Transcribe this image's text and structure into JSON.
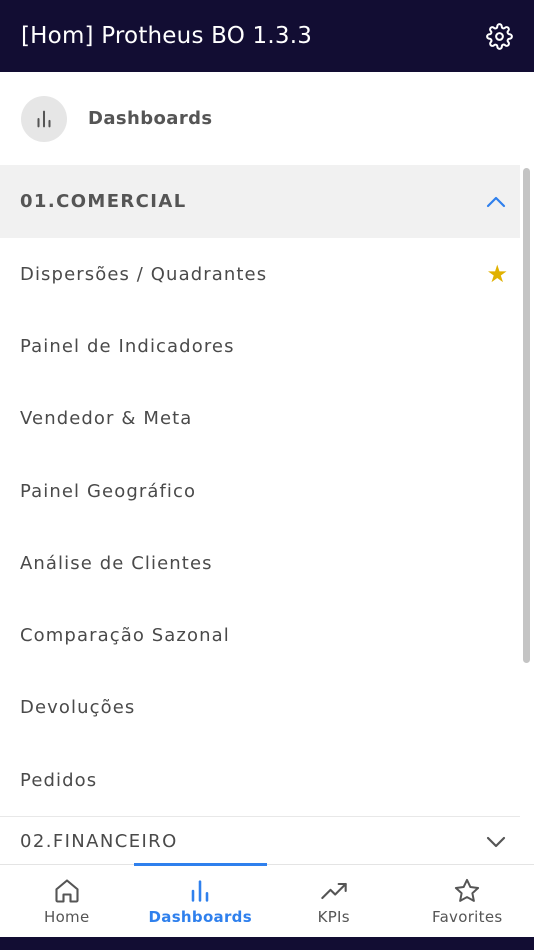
{
  "app": {
    "title": "[Hom] Protheus BO 1.3.3",
    "header_bg": "#120d33",
    "accent": "#2f80ed",
    "favorite_color": "#e0b100",
    "settings_icon": "gear-icon"
  },
  "subheader": {
    "title": "Dashboards",
    "icon": "bar-chart-icon"
  },
  "sections": [
    {
      "title": "01.COMERCIAL",
      "expanded": true,
      "toggle_icon": "chevron-up-icon",
      "items": [
        {
          "label": "Dispersões / Quadrantes",
          "favorite": true,
          "favorite_icon": "star-filled-icon"
        },
        {
          "label": "Painel de Indicadores",
          "favorite": false
        },
        {
          "label": "Vendedor & Meta",
          "favorite": false
        },
        {
          "label": "Painel Geográfico",
          "favorite": false
        },
        {
          "label": "Análise de Clientes",
          "favorite": false
        },
        {
          "label": "Comparação Sazonal",
          "favorite": false
        },
        {
          "label": "Devoluções",
          "favorite": false
        },
        {
          "label": "Pedidos",
          "favorite": false
        }
      ]
    },
    {
      "title": "02.FINANCEIRO",
      "expanded": false,
      "toggle_icon": "chevron-down-icon"
    }
  ],
  "bottom_nav": {
    "active": "Dashboards",
    "items": [
      {
        "label": "Home",
        "icon": "home-icon"
      },
      {
        "label": "Dashboards",
        "icon": "bar-chart-icon"
      },
      {
        "label": "KPIs",
        "icon": "trending-up-icon"
      },
      {
        "label": "Favorites",
        "icon": "star-outline-icon"
      }
    ]
  }
}
